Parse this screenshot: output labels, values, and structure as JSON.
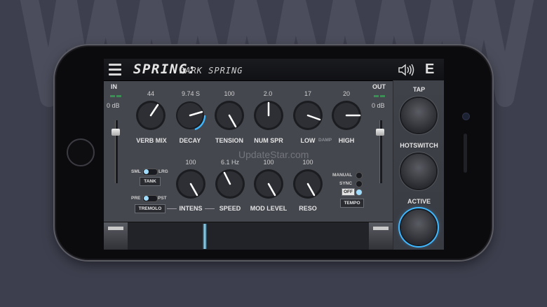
{
  "app": {
    "title": "SPRING:",
    "preset": "DARK SPRING",
    "logo": "E"
  },
  "icons": {
    "menu": "menu-icon",
    "speaker": "speaker-icon"
  },
  "colors": {
    "accent": "#3fb7ff",
    "panel": "#45474f",
    "topbar": "#101114"
  },
  "input": {
    "label": "IN",
    "level": "0 dB"
  },
  "output": {
    "label": "OUT",
    "level": "0 dB"
  },
  "knobs_top": [
    {
      "label": "VERB MIX",
      "value": "44"
    },
    {
      "label": "DECAY",
      "value": "9.74 S"
    },
    {
      "label": "TENSION",
      "value": "100"
    },
    {
      "label": "NUM SPR",
      "value": "2.0"
    },
    {
      "label": "LOW",
      "value": "17"
    },
    {
      "label": "HIGH",
      "value": "20"
    }
  ],
  "damp_label": "DAMP",
  "knobs_bottom": [
    {
      "label": "INTENS",
      "value": "100"
    },
    {
      "label": "SPEED",
      "value": "6.1 Hz"
    },
    {
      "label": "MOD LEVEL",
      "value": "100"
    },
    {
      "label": "RESO",
      "value": "100"
    }
  ],
  "tank": {
    "left": "SML",
    "right": "LRG",
    "button": "TANK"
  },
  "tremolo": {
    "left": "PRE",
    "right": "PST",
    "button": "TREMOLO"
  },
  "tempo": {
    "options": [
      "MANUAL",
      "SYNC",
      "OFF"
    ],
    "selected": "OFF",
    "button": "TEMPO"
  },
  "buttons": {
    "tap": "TAP",
    "hotswitch": "HOTSWITCH",
    "active": "ACTIVE"
  },
  "watermark": "UpdateStar.com"
}
